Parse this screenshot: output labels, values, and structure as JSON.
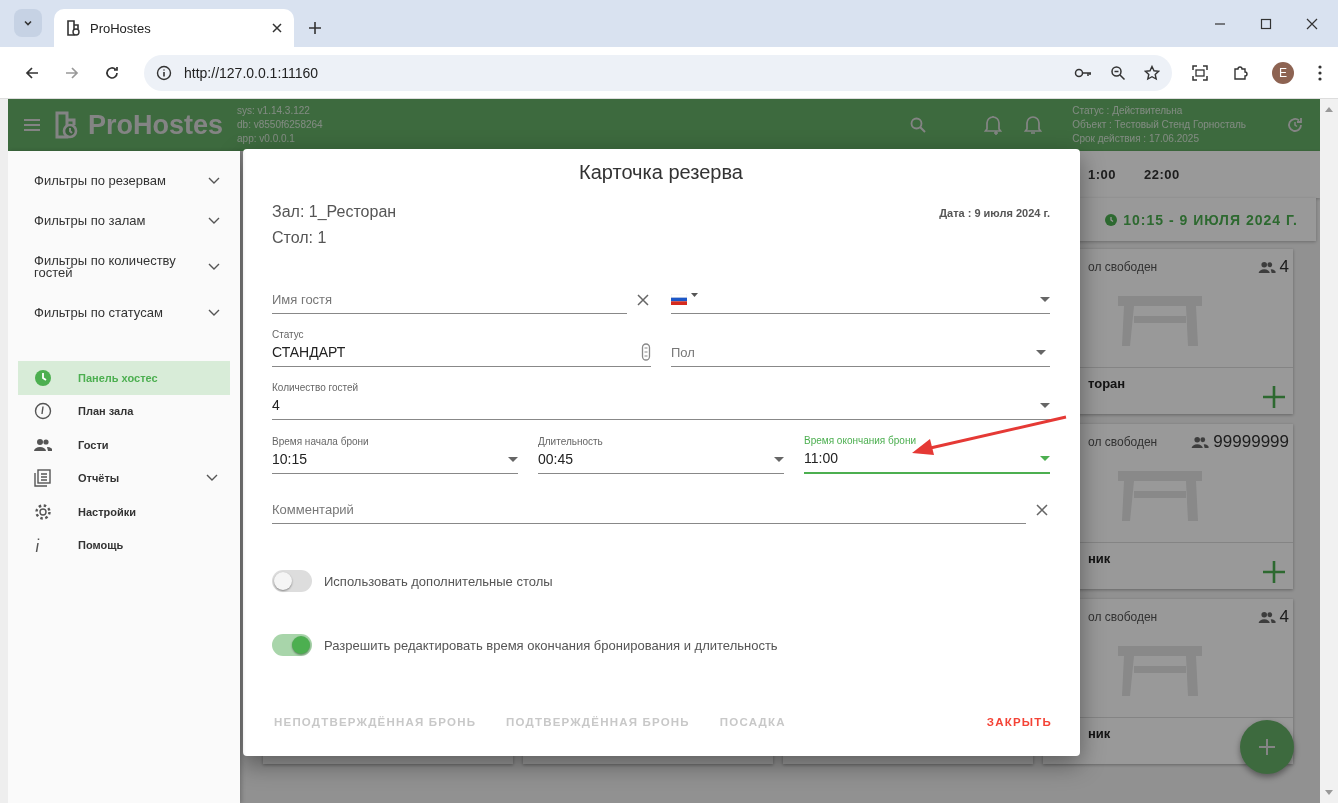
{
  "browser": {
    "tab_title": "ProHostes",
    "url": "http://127.0.0.1:11160",
    "profile": "E"
  },
  "header": {
    "brand": "ProHostes",
    "versions": [
      "sys: v1.14.3.122",
      "db: v8550f6258264",
      "app: v0.0.0.1"
    ],
    "license": [
      "Статус : Действительна",
      "Объект : Тестовый Стенд Горносталь",
      "Срок действия : 17.06.2025"
    ]
  },
  "sidebar": {
    "filters": [
      {
        "label": "Фильтры по резервам"
      },
      {
        "label": "Фильтры по залам"
      },
      {
        "label": "Фильтры по количеству гостей"
      },
      {
        "label": "Фильтры по статусам"
      }
    ],
    "nav": [
      {
        "label": "Панель хостес",
        "selected": true,
        "has_submenu": false
      },
      {
        "label": "План зала",
        "selected": false,
        "has_submenu": false
      },
      {
        "label": "Гости",
        "selected": false,
        "has_submenu": false
      },
      {
        "label": "Отчёты",
        "selected": false,
        "has_submenu": true
      },
      {
        "label": "Настройки",
        "selected": false,
        "has_submenu": false
      },
      {
        "label": "Помощь",
        "selected": false,
        "has_submenu": false
      }
    ]
  },
  "background": {
    "times": [
      "1:00",
      "22:00"
    ],
    "current": "10:15 - 9 ИЮЛЯ 2024 Г.",
    "cards": [
      {
        "status": "ол свободен",
        "guests": "4",
        "name": "торан"
      },
      {
        "status": "ол свободен",
        "guests": "99999999",
        "name": "ник"
      },
      {
        "status": "ол свободен",
        "guests": "4",
        "name": "ник"
      }
    ]
  },
  "dialog": {
    "title": "Карточка резерва",
    "hall": "Зал: 1_Ресторан",
    "table": "Стол: 1",
    "date": "Дата : 9 июля 2024 г.",
    "rows": [
      [
        {
          "kind": "clearable",
          "placeholder": "Имя гостя",
          "focused": false
        },
        {
          "kind": "phone",
          "focused": false
        }
      ],
      [
        {
          "kind": "tagged",
          "label": "Статус",
          "value": "СТАНДАРТ",
          "focused": false
        },
        {
          "kind": "select",
          "placeholder": "Пол",
          "focused": false
        }
      ],
      [
        {
          "kind": "select",
          "label": "Количество гостей",
          "value": "4",
          "focused": false
        }
      ],
      [
        {
          "kind": "select",
          "label": "Время начала брони",
          "value": "10:15",
          "focused": false
        },
        {
          "kind": "select",
          "label": "Длительность",
          "value": "00:45",
          "focused": false
        },
        {
          "kind": "select",
          "label": "Время окончания брони",
          "value": "11:00",
          "focused": true
        }
      ],
      [
        {
          "kind": "clearable",
          "placeholder": "Комментарий",
          "focused": false
        }
      ]
    ],
    "toggles": [
      {
        "label": "Использовать дополнительные столы",
        "on": false
      },
      {
        "label": "Разрешить редактировать время окончания бронирования и длительность",
        "on": true
      }
    ],
    "buttons": [
      {
        "label": "НЕПОДТВЕРЖДЁННАЯ БРОНЬ",
        "kind": "action",
        "disabled": true
      },
      {
        "label": "ПОДТВЕРЖДЁННАЯ БРОНЬ",
        "kind": "action",
        "disabled": true
      },
      {
        "label": "ПОСАДКА",
        "kind": "action",
        "disabled": true
      },
      {
        "label": "ЗАКРЫТЬ",
        "kind": "close",
        "disabled": false
      }
    ]
  }
}
